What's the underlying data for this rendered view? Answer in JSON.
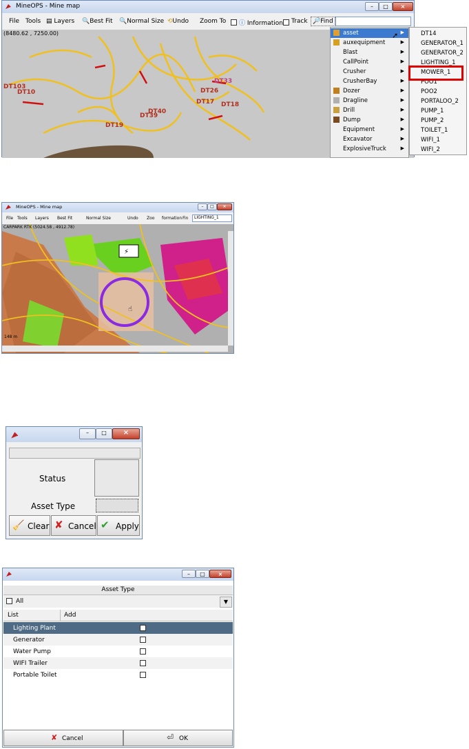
{
  "win1": {
    "title": "MineOPS - Mine map",
    "menu": [
      "File",
      "Tools",
      "Layers",
      "Best Fit",
      "Normal Size",
      "Undo",
      "Zoom To",
      "Information",
      "Track",
      "Find"
    ],
    "coords": "(8480.62 , 7250.00)",
    "map_labels": [
      "DT103",
      "DT10",
      "DT33",
      "DT26",
      "DT17",
      "DT18",
      "DT40",
      "DT39",
      "DT19"
    ],
    "dropdown": [
      "asset",
      "auxequipment",
      "Blast",
      "CallPoint",
      "Crusher",
      "CrusherBay",
      "Dozer",
      "Dragline",
      "Drill",
      "Dump",
      "Equipment",
      "Excavator",
      "ExplosiveTruck"
    ],
    "submenu": [
      "DT14",
      "GENERATOR_1",
      "GENERATOR_2",
      "LIGHTING_1",
      "MOWER_1",
      "POO1",
      "POO2",
      "PORTALOO_2",
      "PUMP_1",
      "PUMP_2",
      "TOILET_1",
      "WIFI_1",
      "WIFI_2"
    ]
  },
  "win2": {
    "title": "MineOPS - Mine map",
    "menu": [
      "File",
      "Tools",
      "Layers",
      "Best Fit",
      "Normal Size",
      "Undo",
      "Zoo",
      "formation",
      "Fin"
    ],
    "find_value": "LIGHTING_1",
    "coords": "CARPARK RTK (5024.58 , 4912.78)",
    "scale": "148 m"
  },
  "win3": {
    "status_label": "Status",
    "asset_type_label": "Asset Type",
    "clear": "Clear",
    "cancel": "Cancel",
    "apply": "Apply"
  },
  "win4": {
    "header": "Asset Type",
    "all_label": "All",
    "col_list": "List",
    "col_add": "Add",
    "rows": [
      "Lighting Plant",
      "Generator",
      "Water Pump",
      "WIFI Trailer",
      "Portable Toilet"
    ],
    "cancel": "Cancel",
    "ok": "OK"
  },
  "colors": {
    "highlight_box": "#e00000",
    "circle": "#8a2be2",
    "row_selected": "#4e6a85"
  }
}
